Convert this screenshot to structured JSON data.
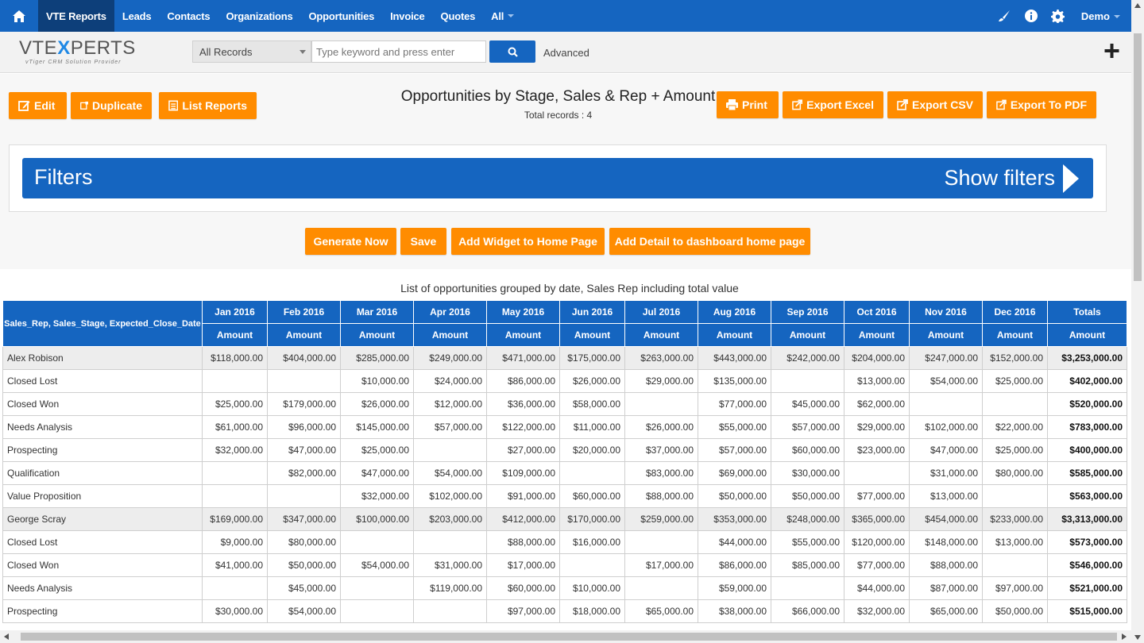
{
  "nav": {
    "items": [
      "VTE Reports",
      "Leads",
      "Contacts",
      "Organizations",
      "Opportunities",
      "Invoice",
      "Quotes",
      "All"
    ],
    "user": "Demo"
  },
  "logo": {
    "left": "VTE",
    "x": "X",
    "right": "PERTS",
    "tagline": "vTiger CRM Solution Provider"
  },
  "search": {
    "record_select": "All Records",
    "placeholder": "Type keyword and press enter",
    "advanced": "Advanced"
  },
  "toolbar": {
    "edit": "Edit",
    "duplicate": "Duplicate",
    "list_reports": "List Reports",
    "print": "Print",
    "export_excel": "Export Excel",
    "export_csv": "Export CSV",
    "export_pdf": "Export To PDF"
  },
  "report": {
    "title": "Opportunities by Stage, Sales & Rep + Amount",
    "total_records": "Total records : 4"
  },
  "filters": {
    "title": "Filters",
    "show": "Show filters"
  },
  "actions": {
    "generate": "Generate Now",
    "save": "Save",
    "add_widget": "Add Widget to Home Page",
    "add_detail": "Add Detail to dashboard home page"
  },
  "table": {
    "caption": "List of opportunities grouped by date, Sales Rep including total value",
    "group_header": "Sales_Rep, Sales_Stage, Expected_Close_Date",
    "months": [
      "Jan 2016",
      "Feb 2016",
      "Mar 2016",
      "Apr 2016",
      "May 2016",
      "Jun 2016",
      "Jul 2016",
      "Aug 2016",
      "Sep 2016",
      "Oct 2016",
      "Nov 2016",
      "Dec 2016",
      "Totals"
    ],
    "subheader": "Amount",
    "rows": [
      {
        "label": "Alex Robison",
        "group": true,
        "values": [
          "$118,000.00",
          "$404,000.00",
          "$285,000.00",
          "$249,000.00",
          "$471,000.00",
          "$175,000.00",
          "$263,000.00",
          "$443,000.00",
          "$242,000.00",
          "$204,000.00",
          "$247,000.00",
          "$152,000.00",
          "$3,253,000.00"
        ]
      },
      {
        "label": "Closed Lost",
        "group": false,
        "values": [
          "",
          "",
          "$10,000.00",
          "$24,000.00",
          "$86,000.00",
          "$26,000.00",
          "$29,000.00",
          "$135,000.00",
          "",
          "$13,000.00",
          "$54,000.00",
          "$25,000.00",
          "$402,000.00"
        ]
      },
      {
        "label": "Closed Won",
        "group": false,
        "values": [
          "$25,000.00",
          "$179,000.00",
          "$26,000.00",
          "$12,000.00",
          "$36,000.00",
          "$58,000.00",
          "",
          "$77,000.00",
          "$45,000.00",
          "$62,000.00",
          "",
          "",
          "$520,000.00"
        ]
      },
      {
        "label": "Needs Analysis",
        "group": false,
        "values": [
          "$61,000.00",
          "$96,000.00",
          "$145,000.00",
          "$57,000.00",
          "$122,000.00",
          "$11,000.00",
          "$26,000.00",
          "$55,000.00",
          "$57,000.00",
          "$29,000.00",
          "$102,000.00",
          "$22,000.00",
          "$783,000.00"
        ]
      },
      {
        "label": "Prospecting",
        "group": false,
        "values": [
          "$32,000.00",
          "$47,000.00",
          "$25,000.00",
          "",
          "$27,000.00",
          "$20,000.00",
          "$37,000.00",
          "$57,000.00",
          "$60,000.00",
          "$23,000.00",
          "$47,000.00",
          "$25,000.00",
          "$400,000.00"
        ]
      },
      {
        "label": "Qualification",
        "group": false,
        "values": [
          "",
          "$82,000.00",
          "$47,000.00",
          "$54,000.00",
          "$109,000.00",
          "",
          "$83,000.00",
          "$69,000.00",
          "$30,000.00",
          "",
          "$31,000.00",
          "$80,000.00",
          "$585,000.00"
        ]
      },
      {
        "label": "Value Proposition",
        "group": false,
        "values": [
          "",
          "",
          "$32,000.00",
          "$102,000.00",
          "$91,000.00",
          "$60,000.00",
          "$88,000.00",
          "$50,000.00",
          "$50,000.00",
          "$77,000.00",
          "$13,000.00",
          "",
          "$563,000.00"
        ]
      },
      {
        "label": "George Scray",
        "group": true,
        "values": [
          "$169,000.00",
          "$347,000.00",
          "$100,000.00",
          "$203,000.00",
          "$412,000.00",
          "$170,000.00",
          "$259,000.00",
          "$353,000.00",
          "$248,000.00",
          "$365,000.00",
          "$454,000.00",
          "$233,000.00",
          "$3,313,000.00"
        ]
      },
      {
        "label": "Closed Lost",
        "group": false,
        "values": [
          "$9,000.00",
          "$80,000.00",
          "",
          "",
          "$88,000.00",
          "$16,000.00",
          "",
          "$44,000.00",
          "$55,000.00",
          "$120,000.00",
          "$148,000.00",
          "$13,000.00",
          "$573,000.00"
        ]
      },
      {
        "label": "Closed Won",
        "group": false,
        "values": [
          "$41,000.00",
          "$50,000.00",
          "$54,000.00",
          "$31,000.00",
          "$17,000.00",
          "",
          "$17,000.00",
          "$86,000.00",
          "$85,000.00",
          "$77,000.00",
          "$88,000.00",
          "",
          "$546,000.00"
        ]
      },
      {
        "label": "Needs Analysis",
        "group": false,
        "values": [
          "",
          "$45,000.00",
          "",
          "$119,000.00",
          "$60,000.00",
          "$10,000.00",
          "",
          "$59,000.00",
          "",
          "$44,000.00",
          "$87,000.00",
          "$97,000.00",
          "$521,000.00"
        ]
      },
      {
        "label": "Prospecting",
        "group": false,
        "values": [
          "$30,000.00",
          "$54,000.00",
          "",
          "",
          "$97,000.00",
          "$18,000.00",
          "$65,000.00",
          "$38,000.00",
          "$66,000.00",
          "$32,000.00",
          "$65,000.00",
          "$50,000.00",
          "$515,000.00"
        ]
      }
    ]
  },
  "colors": {
    "nav_blue": "#1565c0",
    "nav_active": "#0d3f7a",
    "orange": "#ff8c00",
    "group_row": "#ededed"
  }
}
